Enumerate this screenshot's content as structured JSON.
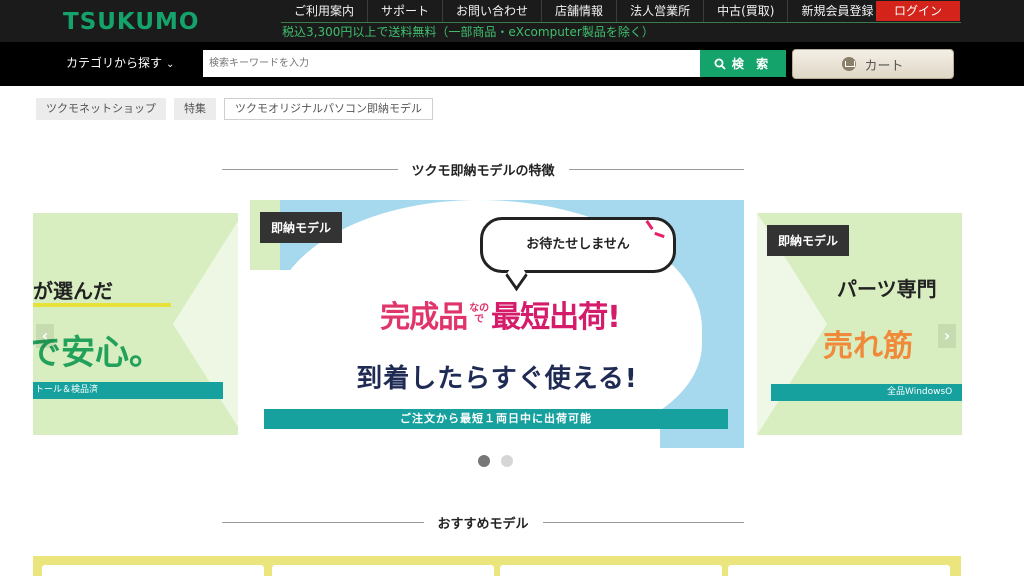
{
  "header": {
    "logo": "TSUKUMO",
    "nav": [
      "ご利用案内",
      "サポート",
      "お問い合わせ",
      "店舗情報",
      "法人営業所",
      "中古(買取)",
      "新規会員登録"
    ],
    "login": "ログイン",
    "shipping_note": "税込3,300円以上で送料無料（一部商品・eXcomputer製品を除く）"
  },
  "searchbar": {
    "category": "カテゴリから探す",
    "placeholder": "検索キーワードを入力",
    "search_button": "検 索",
    "cart_button": "カート"
  },
  "breadcrumb": [
    "ツクモネットショップ",
    "特集",
    "ツクモオリジナルパソコン即納モデル"
  ],
  "features": {
    "title": "ツクモ即納モデルの特徴",
    "main_slide": {
      "tag": "即納モデル",
      "bubble": "お待たせしません",
      "headline_1": "完成品",
      "headline_small": "なので",
      "headline_2": "最短出荷!",
      "subheadline": "到着したらすぐ使える!",
      "band": "ご注文から最短１両日中に出荷可能"
    },
    "left_slide": {
      "line1": "が選んだ",
      "big": "で安心。",
      "band": "トール＆検品済"
    },
    "right_slide": {
      "tag": "即納モデル",
      "line1": "パーツ専門",
      "big": "売れ筋",
      "band": "全品WindowsO"
    },
    "prev_arrow": "‹",
    "next_arrow": "›"
  },
  "recommended": {
    "title": "おすすめモデル"
  }
}
